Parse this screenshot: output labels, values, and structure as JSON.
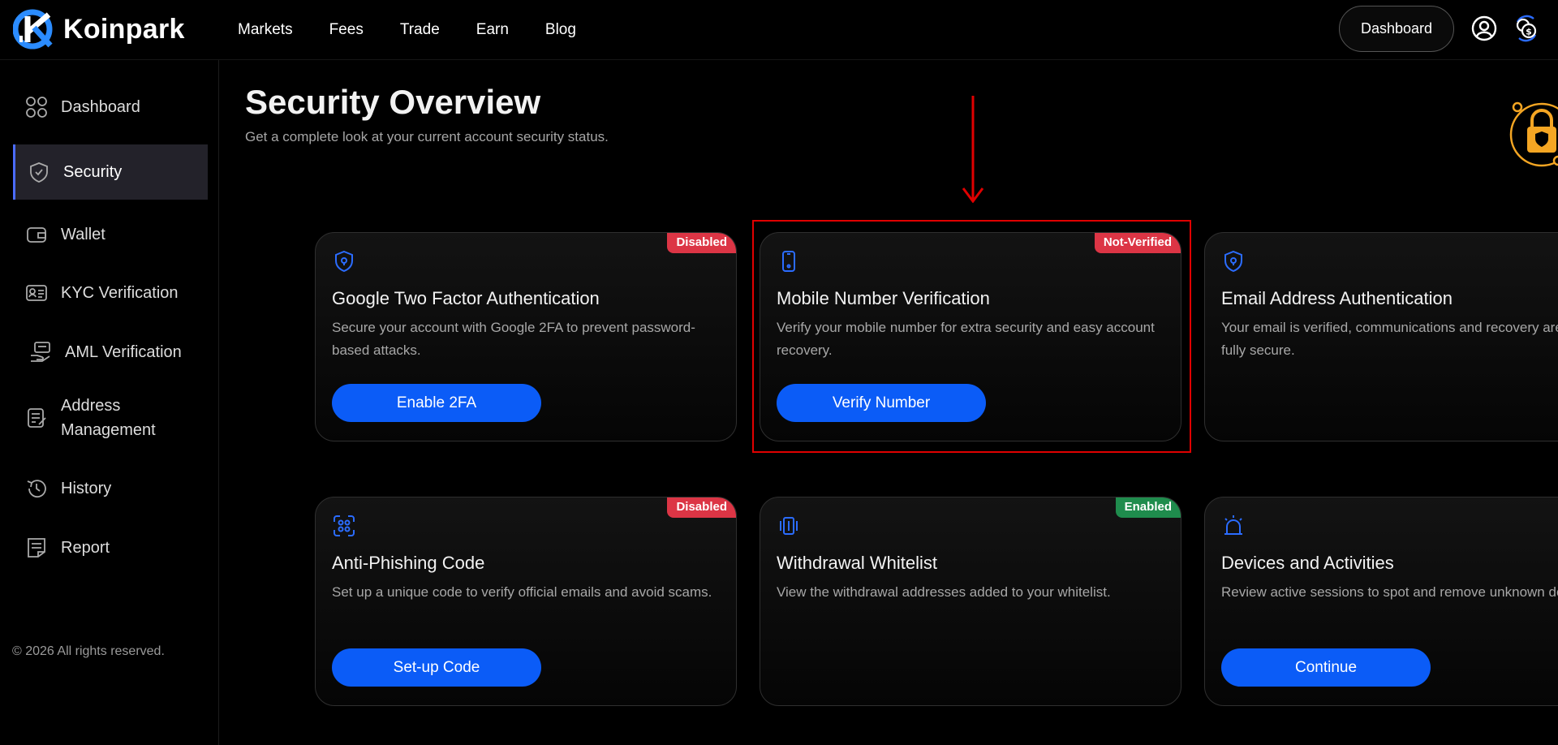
{
  "brand": {
    "name": "Koinpark"
  },
  "nav": {
    "items": [
      "Markets",
      "Fees",
      "Trade",
      "Earn",
      "Blog"
    ]
  },
  "header": {
    "dashboard_label": "Dashboard"
  },
  "sidebar": {
    "items": [
      {
        "label": "Dashboard",
        "icon": "grid-icon"
      },
      {
        "label": "Security",
        "icon": "shield-icon",
        "active": true
      },
      {
        "label": "Wallet",
        "icon": "wallet-icon"
      },
      {
        "label": "KYC Verification",
        "icon": "id-card-icon"
      },
      {
        "label": "AML Verification",
        "icon": "hand-card-icon"
      },
      {
        "label": "Address Management",
        "icon": "notepad-icon"
      },
      {
        "label": "History",
        "icon": "history-icon"
      },
      {
        "label": "Report",
        "icon": "report-icon"
      }
    ],
    "copyright": "© 2026 All rights reserved."
  },
  "page": {
    "title": "Security Overview",
    "subtitle": "Get a complete look at your current account security status."
  },
  "cards": [
    {
      "title": "Google Two Factor Authentication",
      "description": "Secure your account with Google 2FA to prevent password-based attacks.",
      "badge": "Disabled",
      "button": "Enable 2FA",
      "icon": "shield-icon"
    },
    {
      "title": "Mobile Number Verification",
      "description": "Verify your mobile number for extra security and easy account recovery.",
      "badge": "Not-Verified",
      "button": "Verify Number",
      "icon": "mobile-icon"
    },
    {
      "title": "Email Address Authentication",
      "description": "Your email is verified, communications and recovery are now fully secure.",
      "badge": "",
      "button": "",
      "icon": "shield-icon"
    },
    {
      "title": "Anti-Phishing Code",
      "description": "Set up a unique code to verify official emails and avoid scams.",
      "badge": "Disabled",
      "button": "Set-up Code",
      "icon": "scan-icon"
    },
    {
      "title": "Withdrawal Whitelist",
      "description": "View the withdrawal addresses added to your whitelist.",
      "badge": "Enabled",
      "button": "",
      "icon": "whitelist-icon"
    },
    {
      "title": "Devices and Activities",
      "description": "Review active sessions to spot and remove unknown devices.",
      "badge": "",
      "button": "Continue",
      "icon": "alarm-icon"
    }
  ],
  "colors": {
    "accent": "#0b5cf7",
    "badge_red": "#dc3545",
    "badge_green": "#1f8c4d",
    "highlight": "#e00000",
    "lock": "#f5a623"
  }
}
